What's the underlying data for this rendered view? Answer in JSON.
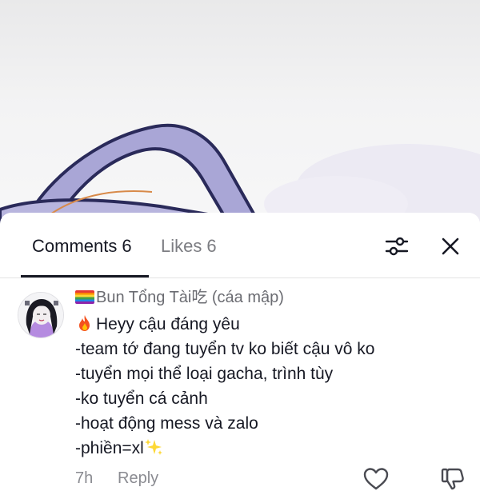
{
  "tabs": {
    "comments_label": "Comments",
    "comments_count": "6",
    "likes_label": "Likes",
    "likes_count": "6"
  },
  "comment": {
    "username": "Bun Tổng Tài吃 (cáa mập)",
    "lines": [
      "Heyy cậu đáng yêu",
      "-team tớ đang tuyển tv ko biết cậu vô ko",
      "-tuyển mọi thể loại gacha, trình tùy",
      "-ko tuyển cá cảnh",
      "-hoạt động mess và zalo",
      "-phiền=xl"
    ],
    "time": "7h",
    "reply_label": "Reply"
  },
  "icons": {
    "filter": "sliders-icon",
    "close": "close-icon",
    "like": "heart-outline-icon",
    "dislike": "thumbs-down-icon",
    "first_line_emoji": "fire-emoji",
    "last_line_emoji": "sparkles-emoji",
    "username_prefix": "rainbow-flag-emoji"
  },
  "colors": {
    "text_primary": "#161823",
    "text_secondary": "#8a8b91",
    "tab_inactive": "#7c7d82",
    "background_art": "#a9a6d6"
  }
}
